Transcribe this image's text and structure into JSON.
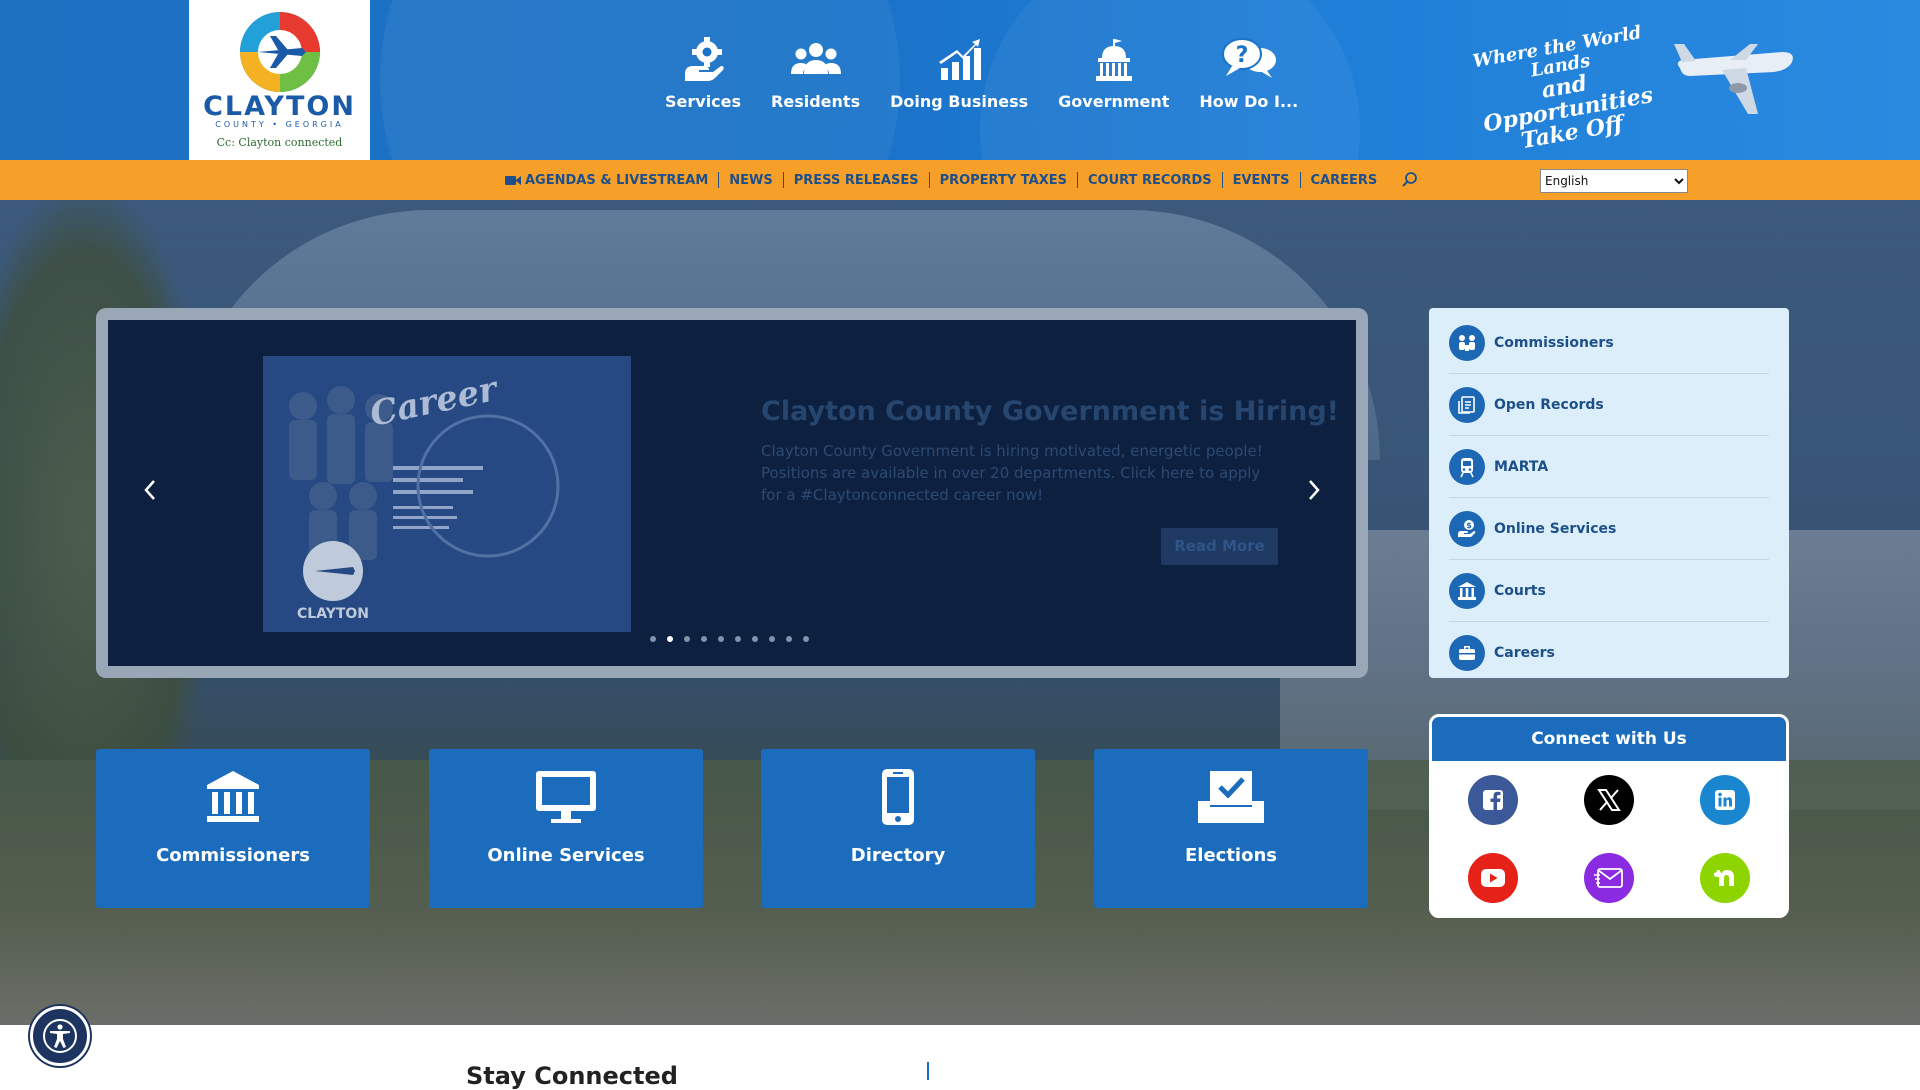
{
  "header": {
    "logo": {
      "name": "CLAYTON",
      "subtitle": "COUNTY • GEORGIA",
      "tagline": "Cc: Clayton connected"
    },
    "nav": [
      {
        "label": "Services",
        "icon": "hand-gear-icon"
      },
      {
        "label": "Residents",
        "icon": "people-icon"
      },
      {
        "label": "Doing Business",
        "icon": "growth-chart-icon"
      },
      {
        "label": "Government",
        "icon": "capitol-icon"
      },
      {
        "label": "How Do I...",
        "icon": "question-bubbles-icon"
      }
    ],
    "slogan": {
      "line1": "Where the World Lands",
      "line2": "and Opportunities",
      "line3": "Take Off"
    }
  },
  "utility_bar": {
    "links": [
      "AGENDAS & LIVESTREAM",
      "NEWS",
      "PRESS RELEASES",
      "PROPERTY TAXES",
      "COURT RECORDS",
      "EVENTS",
      "CAREERS"
    ],
    "language": "English",
    "language_options": [
      "English"
    ]
  },
  "slider": {
    "title": "Clayton County Government is Hiring!",
    "description": "Clayton County Government is hiring motivated, energetic people! Positions are available in over 20 departments. Click here to apply for a #Claytonconnected career now!",
    "button": "Read More",
    "image_text": "Career",
    "image_logo": "CLAYTON",
    "slide_count": 10,
    "active_slide": 2
  },
  "quick_links": [
    {
      "label": "Commissioners",
      "icon": "commissioners-icon"
    },
    {
      "label": "Open Records",
      "icon": "records-icon"
    },
    {
      "label": "MARTA",
      "icon": "train-icon"
    },
    {
      "label": "Online Services",
      "icon": "online-payment-icon"
    },
    {
      "label": "Courts",
      "icon": "courthouse-icon"
    },
    {
      "label": "Careers",
      "icon": "briefcase-icon"
    }
  ],
  "tiles": [
    {
      "label": "Commissioners",
      "icon": "building-columns-icon"
    },
    {
      "label": "Online Services",
      "icon": "monitor-icon"
    },
    {
      "label": "Directory",
      "icon": "mobile-phone-icon"
    },
    {
      "label": "Elections",
      "icon": "ballot-check-icon"
    }
  ],
  "connect": {
    "title": "Connect with Us",
    "social": [
      {
        "name": "facebook-icon",
        "color": "#3b5998"
      },
      {
        "name": "x-icon",
        "color": "#000000"
      },
      {
        "name": "linkedin-icon",
        "color": "#0a66c2"
      },
      {
        "name": "youtube-icon",
        "color": "#e62117"
      },
      {
        "name": "email-icon",
        "color": "#8a2be2"
      },
      {
        "name": "nextdoor-icon",
        "color": "#8ed500"
      }
    ]
  },
  "stay_connected": {
    "title": "Stay Connected"
  },
  "colors": {
    "header_blue": "#1b73c9",
    "utility_orange": "#f6a02a",
    "tile_blue": "#1b6cbc",
    "nav_text": "#1d4f8a"
  }
}
